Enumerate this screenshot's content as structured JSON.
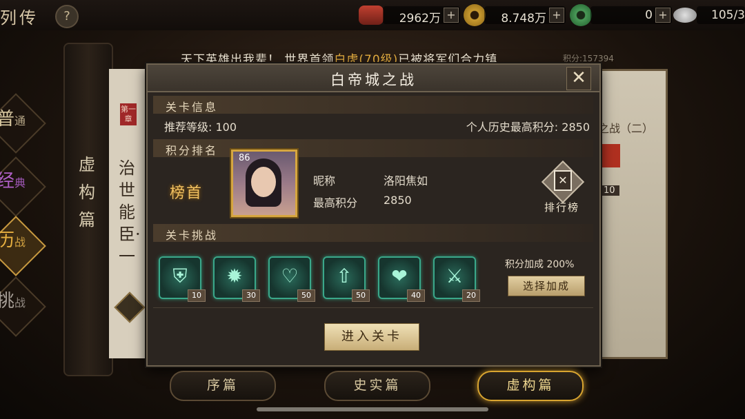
{
  "top": {
    "title": "列传",
    "help": "?",
    "resources": [
      {
        "value": "2962万",
        "plus": "+",
        "icon": "ingot-icon"
      },
      {
        "value": "8.748万",
        "plus": "+",
        "icon": "coin-icon"
      },
      {
        "value": "0",
        "plus": "+",
        "icon": "jade-icon"
      },
      {
        "value": "105/3",
        "icon": "stamina-icon"
      }
    ]
  },
  "side_menu": [
    {
      "label": "普",
      "sub": "通"
    },
    {
      "label": "经",
      "sub": "典"
    },
    {
      "label": "历",
      "sub": "战"
    },
    {
      "label": "挑",
      "sub": "战"
    }
  ],
  "background": {
    "scroll_title": "虚构篇",
    "paper_text": "治世能臣·一",
    "chapter_seal": "第一章",
    "right_card_title": "之战（二）",
    "right_card_num": "10"
  },
  "marquee": {
    "prefix": "天下英雄出我辈！ 世界首领",
    "boss": "白虎(70级)",
    "suffix": "已被将军们合力镇",
    "score_hint": "积分:157394"
  },
  "modal": {
    "title": "白帝城之战",
    "close": "✕",
    "info": {
      "header": "关卡信息",
      "recommended_label": "推荐等级:",
      "recommended_value": "100",
      "best_label": "个人历史最高积分:",
      "best_value": "2850"
    },
    "ranking": {
      "header": "积分排名",
      "rank_title": "榜首",
      "level": "86",
      "nickname_label": "昵称",
      "nickname": "洛阳焦如",
      "score_label": "最高积分",
      "score": "2850",
      "leaderboard_button": "排行榜"
    },
    "challenge": {
      "header": "关卡挑战",
      "buffs": [
        {
          "icon": "shield-icon",
          "glyph": "⛨",
          "cost": "10"
        },
        {
          "icon": "shield-burst-icon",
          "glyph": "✹",
          "cost": "30"
        },
        {
          "icon": "shield-heart-icon",
          "glyph": "♡",
          "cost": "50"
        },
        {
          "icon": "shield-up-icon",
          "glyph": "⇧",
          "cost": "50"
        },
        {
          "icon": "hearts-icon",
          "glyph": "❤",
          "cost": "40"
        },
        {
          "icon": "sword-up-icon",
          "glyph": "⚔",
          "cost": "20"
        }
      ],
      "bonus_label": "积分加成 200%",
      "choose_button": "选择加成"
    },
    "enter_button": "进入关卡"
  },
  "bottom_tabs": [
    {
      "label": "序篇",
      "active": false
    },
    {
      "label": "史实篇",
      "active": false
    },
    {
      "label": "虚构篇",
      "active": true
    }
  ],
  "colors": {
    "accent_gold": "#d9a530",
    "buff_teal": "#3aa88a",
    "boss_text": "#e8b040"
  }
}
